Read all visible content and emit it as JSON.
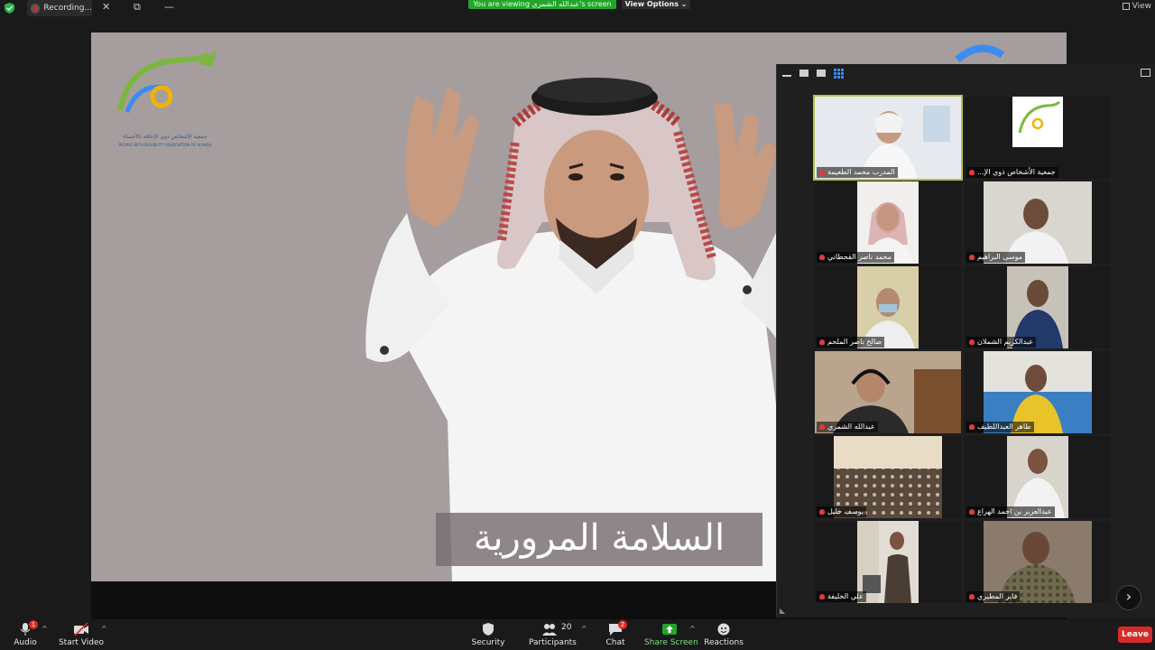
{
  "topbar": {
    "recording_label": "Recording...",
    "viewing_banner": "You are viewing عبدالله الشمري's screen",
    "view_options_label": "View Options",
    "view_label": "View"
  },
  "shared_screen": {
    "logo_text_ar": "جمعية الأشخاص ذوي الإعاقة بالأحساء",
    "logo_text_en": "PEOPLE WITH DISABILITY ASSOCIATION OF ALAHSA",
    "caption": "السلامة المرورية"
  },
  "participants": [
    {
      "name": "المدرب محمد الطعيمة"
    },
    {
      "name": "...جمعية الأشخاص ذوي الإ"
    },
    {
      "name": "محمد ناصر القحطاني"
    },
    {
      "name": "موسى البراهيم"
    },
    {
      "name": "صالح ناصر الملحم"
    },
    {
      "name": "عبدالكريم الشملان"
    },
    {
      "name": "عبدالله الشمري"
    },
    {
      "name": "طاهر العبداللطيف"
    },
    {
      "name": "يوسف خليل"
    },
    {
      "name": "عبدالعزيز بن احمد الهراع"
    },
    {
      "name": "علي الخليفة"
    },
    {
      "name": "فايز المطيري"
    }
  ],
  "toolbar": {
    "audio_label": "Audio",
    "audio_badge": "1",
    "start_video_label": "Start Video",
    "security_label": "Security",
    "participants_label": "Participants",
    "participants_count": "20",
    "chat_label": "Chat",
    "chat_badge": "2",
    "share_screen_label": "Share Screen",
    "reactions_label": "Reactions",
    "leave_label": "Leave"
  },
  "colors": {
    "accent_green": "#23a52b",
    "leave_red": "#d62a2a",
    "active_speaker": "#b6c14e"
  }
}
